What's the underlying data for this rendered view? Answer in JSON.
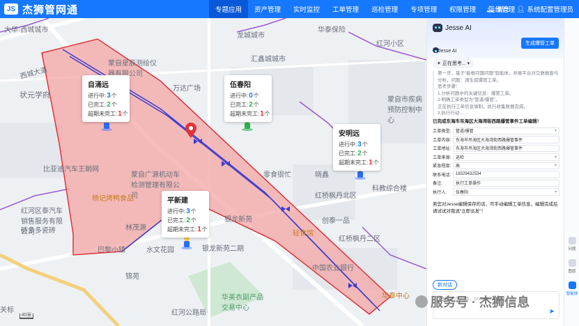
{
  "app": {
    "logo_mark": "JS",
    "title": "杰狮管网通"
  },
  "nav": [
    {
      "label": "专题应用",
      "active": true
    },
    {
      "label": "资产管理"
    },
    {
      "label": "实时监控"
    },
    {
      "label": "工单管理"
    },
    {
      "label": "巡检管理"
    },
    {
      "label": "专项管理"
    },
    {
      "label": "权限管理"
    },
    {
      "label": "运维管理"
    }
  ],
  "header_right": {
    "messages": "消息",
    "user": "系统配置管理员"
  },
  "map": {
    "places": [
      "大华·西城城市",
      "龙城城市",
      "华泰保险",
      "红河小区",
      "汇鑫城城市",
      "蒙自星辰测绘仪器有限公司",
      "万达广场",
      "伍春阳",
      "状元学府",
      "西城大道",
      "比亚迪汽车王朝网",
      "蒙自广源机动车检测管理有限公司",
      "红河区泰汽车销售服务有限公司",
      "砖多多瓷砖",
      "巴黎小镇",
      "林茂源",
      "水文花园",
      "锦苑",
      "华美衣副产品交易中心",
      "红河公路局",
      "银龙新苑",
      "银龙新苑二期",
      "中国农业银行",
      "零食很忙",
      "晓鑫",
      "红桥枫丹北区",
      "红桥枫丹二区",
      "创泰一品",
      "科教综合楼",
      "蒙自市疾病预防控制中心",
      "文化大道",
      "红河州公安局交通警察支队",
      "红河芯北区",
      "轻食馆",
      "杨记烤鸭食品",
      "全家便利店",
      "华泰中心",
      "大华香港府",
      "红河州公路局",
      "关标",
      "梦纪鸭鸣"
    ],
    "scale_label": "40米",
    "cards": [
      {
        "name": "自涌远",
        "in_progress": 3,
        "done": 2,
        "overdue": 1
      },
      {
        "name": "伍春阳",
        "in_progress": 0,
        "done": 2,
        "overdue": 1
      },
      {
        "name": "安明远",
        "in_progress": 3,
        "done": 2,
        "overdue": 1
      },
      {
        "name": "平新建",
        "in_progress": 3,
        "done": 2,
        "overdue": 1
      }
    ],
    "labels": {
      "in_progress": "进行中:",
      "done": "已完工:",
      "overdue": "超期未完工:",
      "unit": "个"
    },
    "colors": {
      "zone_fill": "#f4a6a6",
      "zone_stroke": "#e0333a",
      "route": "#3c3ccf",
      "road_purple": "#9b59d0"
    }
  },
  "assistant": {
    "title": "Jesse AI",
    "new_button": "生成爆管工单",
    "agent_name": "Jesse AI",
    "thinking": "正在思考...",
    "reasoning": "第一步，基于“能根问题问题”智能体，并展平台对交数据查与分析，问题：请生成爆管工单。\n思考步骤：\n1.分析问题中的关键信息：爆管工单。\n2.明确工单类型为“管道/爆管”。\n正在执行工单信息填制，执行收集数据完成。\n3.执行行动……",
    "done_text": "已完成东海市吊海区大海湾街西路爆管事件工单编辑！",
    "form": [
      {
        "label": "工单类型:",
        "value": "管道/爆管",
        "select": true
      },
      {
        "label": "工单内容:",
        "value": "东海市吊海区大海湾街西路爆管事件"
      },
      {
        "label": "工单地址:",
        "value": "东海市吊海区大海湾街西路爆管事件"
      },
      {
        "label": "工单来源:",
        "value": "巡检",
        "select": true
      },
      {
        "label": "紧急程度:",
        "value": "高",
        "select": true
      },
      {
        "label": "联系电话:",
        "value": "18329432534"
      },
      {
        "label": "备注:",
        "value": "执行工单操作"
      },
      {
        "label": "执行人:",
        "value": "伍春阳",
        "select": true
      }
    ],
    "hint": "若您对Jesse编辑保存的话，可手动编辑工单信息，编辑完成后请试试对我说“立即派发”！",
    "chat_pill": "新对话",
    "input_placeholder": "请输入您的问题，Shift+Enter换行"
  },
  "rail": [
    {
      "label": "问题"
    },
    {
      "label": "图层"
    },
    {
      "label": "智能体",
      "active": true
    }
  ],
  "watermark": "服务号 · 杰狮信息"
}
